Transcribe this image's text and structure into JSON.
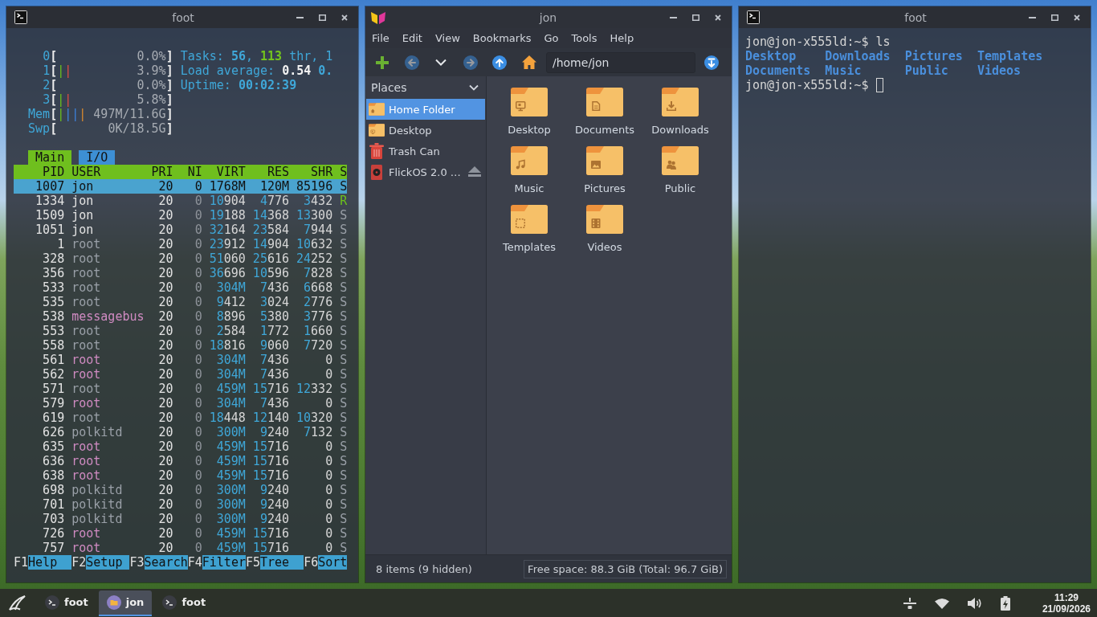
{
  "windows": [
    {
      "kind": "htop",
      "title": "foot",
      "meters": [
        {
          "label": "0",
          "open": "[",
          "value": "0.0%",
          "close": "]"
        },
        {
          "label": "1",
          "open": "[",
          "bars": [
            {
              "kind": "user",
              "text": "|"
            },
            {
              "kind": "kernel",
              "text": "|"
            }
          ],
          "value": "3.9%",
          "close": "]"
        },
        {
          "label": "2",
          "open": "[",
          "value": "0.0%",
          "close": "]"
        },
        {
          "label": "3",
          "open": "[",
          "bars": [
            {
              "kind": "user",
              "text": "|"
            },
            {
              "kind": "kernel",
              "text": "|"
            }
          ],
          "value": "5.8%",
          "close": "]"
        },
        {
          "label": "Mem",
          "open": "[",
          "bars": [
            {
              "kind": "user",
              "text": "|"
            },
            {
              "kind": "buffers",
              "text": "|"
            },
            {
              "kind": "buffers",
              "text": "|"
            },
            {
              "kind": "cache",
              "text": "|"
            }
          ],
          "value": "497M/11.6G",
          "close": "]"
        },
        {
          "label": "Swp",
          "open": "[",
          "value": "0K/18.5G",
          "close": "]"
        }
      ],
      "summary": [
        {
          "segments": [
            {
              "kind": "label",
              "text": "Tasks: "
            },
            {
              "kind": "value",
              "text": "56"
            },
            {
              "kind": "label",
              "text": ", "
            },
            {
              "kind": "highlight",
              "text": "113"
            },
            {
              "kind": "label",
              "text": " thr, 1"
            }
          ]
        },
        {
          "segments": [
            {
              "kind": "label",
              "text": "Load average: "
            },
            {
              "kind": "strong",
              "text": "0.54 "
            },
            {
              "kind": "value",
              "text": "0."
            }
          ]
        },
        {
          "segments": [
            {
              "kind": "label",
              "text": "Uptime: "
            },
            {
              "kind": "value",
              "text": "00:02:39"
            }
          ]
        }
      ],
      "tabs": [
        {
          "label": "Main",
          "selected": true
        },
        {
          "label": "I/O",
          "selected": false
        }
      ],
      "columns": [
        "PID",
        "USER",
        "PRI",
        "NI",
        "VIRT",
        "RES",
        "SHR",
        "S"
      ],
      "rows": [
        {
          "pid": "1007",
          "user": "jon",
          "pri": "20",
          "ni": "0",
          "virt": "1768M",
          "res": "120M",
          "shr": "85196",
          "state": "S",
          "selected": true,
          "running": false
        },
        {
          "pid": "1334",
          "user": "jon",
          "pri": "20",
          "ni": "0",
          "virt": "10904",
          "res": "4776",
          "shr": "3432",
          "state": "R",
          "color": "#e2e2e2",
          "selected": false,
          "running": true
        },
        {
          "pid": "1509",
          "user": "jon",
          "pri": "20",
          "ni": "0",
          "virt": "19188",
          "res": "14368",
          "shr": "13300",
          "state": "S",
          "color": "#e2e2e2",
          "selected": false,
          "running": false
        },
        {
          "pid": "1051",
          "user": "jon",
          "pri": "20",
          "ni": "0",
          "virt": "32164",
          "res": "23584",
          "shr": "7944",
          "state": "S",
          "color": "#e2e2e2",
          "selected": false,
          "running": false
        },
        {
          "pid": "1",
          "user": "root",
          "pri": "20",
          "ni": "0",
          "virt": "23912",
          "res": "14904",
          "shr": "10632",
          "state": "S",
          "color": "#9aa0a8",
          "selected": false,
          "running": false
        },
        {
          "pid": "328",
          "user": "root",
          "pri": "20",
          "ni": "0",
          "virt": "51060",
          "res": "25616",
          "shr": "24252",
          "state": "S",
          "color": "#9aa0a8",
          "selected": false,
          "running": false
        },
        {
          "pid": "356",
          "user": "root",
          "pri": "20",
          "ni": "0",
          "virt": "36696",
          "res": "10596",
          "shr": "7828",
          "state": "S",
          "color": "#9aa0a8",
          "selected": false,
          "running": false
        },
        {
          "pid": "533",
          "user": "root",
          "pri": "20",
          "ni": "0",
          "virt": "304M",
          "res": "7436",
          "shr": "6668",
          "state": "S",
          "color": "#9aa0a8",
          "selected": false,
          "running": false
        },
        {
          "pid": "535",
          "user": "root",
          "pri": "20",
          "ni": "0",
          "virt": "9412",
          "res": "3024",
          "shr": "2776",
          "state": "S",
          "color": "#9aa0a8",
          "selected": false,
          "running": false
        },
        {
          "pid": "538",
          "user": "messagebus",
          "pri": "20",
          "ni": "0",
          "virt": "8896",
          "res": "5380",
          "shr": "3776",
          "state": "S",
          "color": "#d08bc2",
          "selected": false,
          "running": false
        },
        {
          "pid": "553",
          "user": "root",
          "pri": "20",
          "ni": "0",
          "virt": "2584",
          "res": "1772",
          "shr": "1660",
          "state": "S",
          "color": "#9aa0a8",
          "selected": false,
          "running": false
        },
        {
          "pid": "558",
          "user": "root",
          "pri": "20",
          "ni": "0",
          "virt": "18816",
          "res": "9060",
          "shr": "7720",
          "state": "S",
          "color": "#9aa0a8",
          "selected": false,
          "running": false
        },
        {
          "pid": "561",
          "user": "root",
          "pri": "20",
          "ni": "0",
          "virt": "304M",
          "res": "7436",
          "shr": "0",
          "state": "S",
          "color": "#d08bc2",
          "selected": false,
          "running": false
        },
        {
          "pid": "562",
          "user": "root",
          "pri": "20",
          "ni": "0",
          "virt": "304M",
          "res": "7436",
          "shr": "0",
          "state": "S",
          "color": "#d08bc2",
          "selected": false,
          "running": false
        },
        {
          "pid": "571",
          "user": "root",
          "pri": "20",
          "ni": "0",
          "virt": "459M",
          "res": "15716",
          "shr": "12332",
          "state": "S",
          "color": "#9aa0a8",
          "selected": false,
          "running": false
        },
        {
          "pid": "579",
          "user": "root",
          "pri": "20",
          "ni": "0",
          "virt": "304M",
          "res": "7436",
          "shr": "0",
          "state": "S",
          "color": "#d08bc2",
          "selected": false,
          "running": false
        },
        {
          "pid": "619",
          "user": "root",
          "pri": "20",
          "ni": "0",
          "virt": "18448",
          "res": "12140",
          "shr": "10320",
          "state": "S",
          "color": "#9aa0a8",
          "selected": false,
          "running": false
        },
        {
          "pid": "626",
          "user": "polkitd",
          "pri": "20",
          "ni": "0",
          "virt": "300M",
          "res": "9240",
          "shr": "7132",
          "state": "S",
          "color": "#9aa0a8",
          "selected": false,
          "running": false
        },
        {
          "pid": "635",
          "user": "root",
          "pri": "20",
          "ni": "0",
          "virt": "459M",
          "res": "15716",
          "shr": "0",
          "state": "S",
          "color": "#d08bc2",
          "selected": false,
          "running": false
        },
        {
          "pid": "636",
          "user": "root",
          "pri": "20",
          "ni": "0",
          "virt": "459M",
          "res": "15716",
          "shr": "0",
          "state": "S",
          "color": "#d08bc2",
          "selected": false,
          "running": false
        },
        {
          "pid": "638",
          "user": "root",
          "pri": "20",
          "ni": "0",
          "virt": "459M",
          "res": "15716",
          "shr": "0",
          "state": "S",
          "color": "#d08bc2",
          "selected": false,
          "running": false
        },
        {
          "pid": "698",
          "user": "polkitd",
          "pri": "20",
          "ni": "0",
          "virt": "300M",
          "res": "9240",
          "shr": "0",
          "state": "S",
          "color": "#9aa0a8",
          "selected": false,
          "running": false
        },
        {
          "pid": "701",
          "user": "polkitd",
          "pri": "20",
          "ni": "0",
          "virt": "300M",
          "res": "9240",
          "shr": "0",
          "state": "S",
          "color": "#9aa0a8",
          "selected": false,
          "running": false
        },
        {
          "pid": "703",
          "user": "polkitd",
          "pri": "20",
          "ni": "0",
          "virt": "300M",
          "res": "9240",
          "shr": "0",
          "state": "S",
          "color": "#9aa0a8",
          "selected": false,
          "running": false
        },
        {
          "pid": "726",
          "user": "root",
          "pri": "20",
          "ni": "0",
          "virt": "459M",
          "res": "15716",
          "shr": "0",
          "state": "S",
          "color": "#d08bc2",
          "selected": false,
          "running": false
        },
        {
          "pid": "757",
          "user": "root",
          "pri": "20",
          "ni": "0",
          "virt": "459M",
          "res": "15716",
          "shr": "0",
          "state": "S",
          "color": "#d08bc2",
          "selected": false,
          "running": false
        }
      ],
      "function_keys": [
        {
          "key": "F1",
          "label": "Help"
        },
        {
          "key": "F2",
          "label": "Setup"
        },
        {
          "key": "F3",
          "label": "Search"
        },
        {
          "key": "F4",
          "label": "Filter"
        },
        {
          "key": "F5",
          "label": "Tree"
        },
        {
          "key": "F6",
          "label": "Sort"
        }
      ]
    },
    {
      "kind": "file_manager",
      "title": "jon",
      "menu": [
        "File",
        "Edit",
        "View",
        "Bookmarks",
        "Go",
        "Tools",
        "Help"
      ],
      "toolbar": [
        {
          "kind": "new",
          "disabled": false
        },
        {
          "kind": "back",
          "disabled": true
        },
        {
          "kind": "history",
          "disabled": false
        },
        {
          "kind": "forward",
          "disabled": true
        },
        {
          "kind": "up",
          "disabled": false
        },
        {
          "kind": "home",
          "disabled": false
        }
      ],
      "location": "/home/jon",
      "places": {
        "title": "Places",
        "items": [
          {
            "label": "Home Folder",
            "kind": "home",
            "selected": true,
            "ejectable": false
          },
          {
            "label": "Desktop",
            "kind": "desktop",
            "selected": false,
            "ejectable": false
          },
          {
            "label": "Trash Can",
            "kind": "trash",
            "selected": false,
            "ejectable": false
          },
          {
            "label": "FlickOS 2.0 …",
            "kind": "disc",
            "selected": false,
            "ejectable": true
          }
        ]
      },
      "files": [
        {
          "name": "Desktop",
          "kind": "desktop",
          "selected": false
        },
        {
          "name": "Documents",
          "kind": "documents",
          "selected": false
        },
        {
          "name": "Downloads",
          "kind": "downloads",
          "selected": false
        },
        {
          "name": "Music",
          "kind": "music",
          "selected": false
        },
        {
          "name": "Pictures",
          "kind": "pictures",
          "selected": false
        },
        {
          "name": "Public",
          "kind": "public",
          "selected": false
        },
        {
          "name": "Templates",
          "kind": "templates",
          "selected": false
        },
        {
          "name": "Videos",
          "kind": "videos",
          "selected": false
        }
      ],
      "status": "8 items (9 hidden)",
      "free_space": "Free space: 88.3 GiB (Total: 96.7 GiB)"
    },
    {
      "kind": "shell",
      "title": "foot",
      "session": [
        {
          "kind": "command",
          "prompt": "jon@jon-x555ld:~$",
          "input": "ls",
          "cursor": false
        },
        {
          "kind": "listing",
          "entries": [
            "Desktop",
            "Documents",
            "Downloads",
            "Music",
            "Pictures",
            "Public",
            "Templates",
            "Videos"
          ]
        },
        {
          "kind": "command",
          "prompt": "jon@jon-x555ld:~$",
          "cursor": true
        }
      ]
    }
  ],
  "taskbar": {
    "tasks": [
      {
        "label": "foot",
        "kind": "terminal",
        "selected": false
      },
      {
        "label": "jon",
        "kind": "file_manager",
        "selected": true
      },
      {
        "label": "foot",
        "kind": "terminal",
        "selected": false
      }
    ],
    "clock": {
      "time": "11:29",
      "date": "21/09/2026"
    }
  }
}
